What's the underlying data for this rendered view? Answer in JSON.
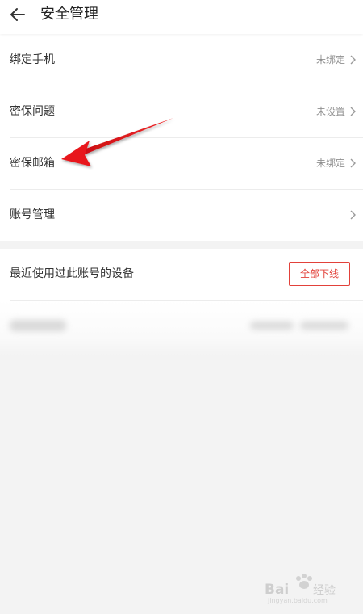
{
  "header": {
    "title": "安全管理",
    "back_icon": "arrow-left-icon"
  },
  "security_items": [
    {
      "label": "绑定手机",
      "status": "未绑定"
    },
    {
      "label": "密保问题",
      "status": "未设置"
    },
    {
      "label": "密保邮箱",
      "status": "未绑定"
    },
    {
      "label": "账号管理",
      "status": ""
    }
  ],
  "devices": {
    "title": "最近使用过此账号的设备",
    "logout_all_label": "全部下线"
  },
  "annotation": {
    "arrow_color": "#e8161a",
    "points_to": "密保邮箱"
  },
  "colors": {
    "accent_red": "#e2413a",
    "status_gray": "#8f8f8f",
    "background": "#f3f3f3"
  }
}
